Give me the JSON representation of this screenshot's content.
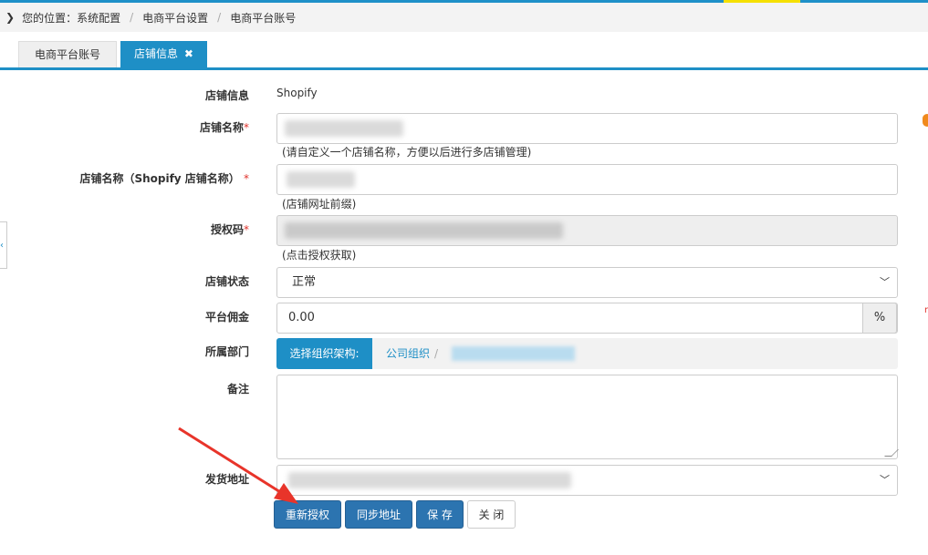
{
  "breadcrumb": {
    "prefix": "您的位置：",
    "items": [
      "系统配置",
      "电商平台设置",
      "电商平台账号"
    ]
  },
  "tabs": [
    {
      "label": "电商平台账号"
    },
    {
      "label": "店铺信息",
      "close": "✖"
    }
  ],
  "form": {
    "store_info": {
      "label": "店铺信息",
      "value": "Shopify"
    },
    "store_name": {
      "label": "店铺名称",
      "required": "*",
      "hint": "(请自定义一个店铺名称，方便以后进行多店铺管理)"
    },
    "shopify_store_name": {
      "label": "店铺名称（Shopify 店铺名称）",
      "required": "*",
      "hint": "(店铺网址前缀)"
    },
    "auth_code": {
      "label": "授权码",
      "required": "*",
      "hint": "(点击授权获取)"
    },
    "store_status": {
      "label": "店铺状态",
      "value": "正常"
    },
    "commission": {
      "label": "平台佣金",
      "value": "0.00",
      "addon": "%"
    },
    "department": {
      "label": "所属部门",
      "button": "选择组织架构:",
      "link": "公司组织",
      "sep": "/"
    },
    "remark": {
      "label": "备注"
    },
    "ship_address": {
      "label": "发货地址"
    }
  },
  "buttons": {
    "reauthorize": "重新授权",
    "sync_address": "同步地址",
    "save": "保 存",
    "close": "关 闭"
  },
  "colors": {
    "primary": "#1e8fc6",
    "button_blue": "#2c74b0",
    "required": "#e0322b",
    "annotation_arrow": "#e8342a"
  }
}
